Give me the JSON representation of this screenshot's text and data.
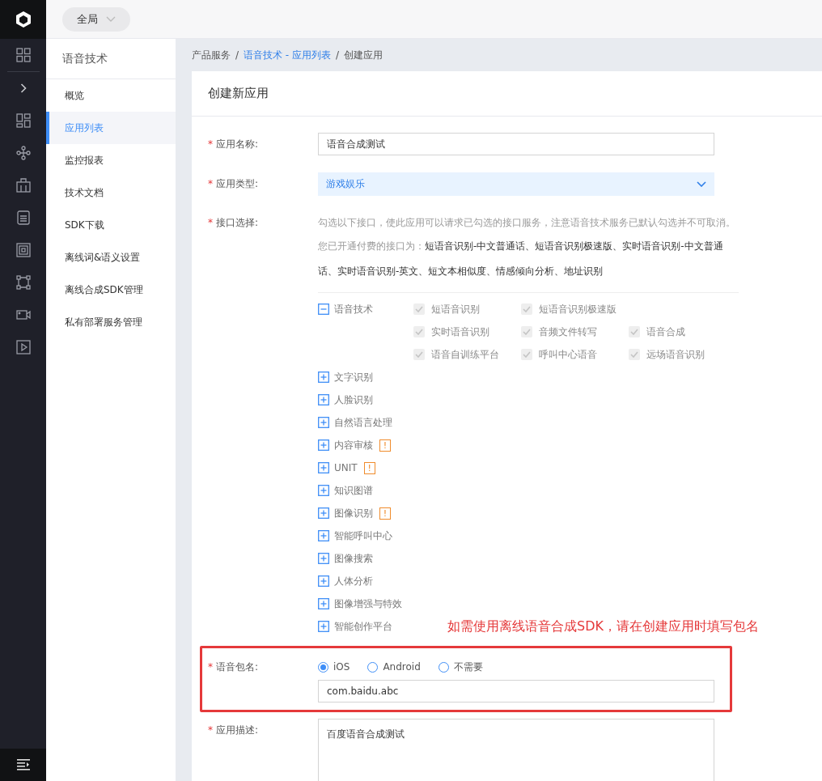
{
  "topbar": {
    "scope": "全局"
  },
  "sidebar": {
    "title": "语音技术",
    "items": [
      {
        "label": "概览",
        "selected": false
      },
      {
        "label": "应用列表",
        "selected": true
      },
      {
        "label": "监控报表",
        "selected": false
      },
      {
        "label": "技术文档",
        "selected": false
      },
      {
        "label": "SDK下载",
        "selected": false
      },
      {
        "label": "离线词&语义设置",
        "selected": false
      },
      {
        "label": "离线合成SDK管理",
        "selected": false
      },
      {
        "label": "私有部署服务管理",
        "selected": false
      }
    ]
  },
  "breadcrumb": [
    {
      "label": "产品服务",
      "link": false
    },
    {
      "label": "语音技术 - 应用列表",
      "link": true
    },
    {
      "label": "创建应用",
      "link": false
    }
  ],
  "breadcrumb_separator": "/",
  "card": {
    "title": "创建新应用"
  },
  "form": {
    "required_mark": "*",
    "app_name": {
      "label": "应用名称:",
      "value": "语音合成测试"
    },
    "app_type": {
      "label": "应用类型:",
      "value": "游戏娱乐"
    },
    "api": {
      "label": "接口选择:",
      "hint": "勾选以下接口，使此应用可以请求已勾选的接口服务，注意语音技术服务已默认勾选并不可取消。",
      "paid_label": "您已开通付费的接口为：",
      "paid_list": "短语音识别-中文普通话、短语音识别极速版、实时语音识别-中文普通话、实时语音识别-英文、短文本相似度、情感倾向分析、地址识别",
      "categories": [
        {
          "label": "语音技术",
          "expanded": true,
          "options": [
            [
              {
                "label": "短语音识别",
                "checked": true,
                "disabled": true
              },
              {
                "label": "短语音识别极速版",
                "checked": true,
                "disabled": true
              }
            ],
            [
              {
                "label": "实时语音识别",
                "checked": true,
                "disabled": true
              },
              {
                "label": "音频文件转写",
                "checked": true,
                "disabled": true
              },
              {
                "label": "语音合成",
                "checked": true,
                "disabled": true
              }
            ],
            [
              {
                "label": "语音自训练平台",
                "checked": true,
                "disabled": true
              },
              {
                "label": "呼叫中心语音",
                "checked": true,
                "disabled": true
              },
              {
                "label": "远场语音识别",
                "checked": true,
                "disabled": true
              }
            ]
          ]
        },
        {
          "label": "文字识别",
          "expanded": false
        },
        {
          "label": "人脸识别",
          "expanded": false
        },
        {
          "label": "自然语言处理",
          "expanded": false
        },
        {
          "label": "内容审核",
          "expanded": false,
          "badge": "!"
        },
        {
          "label": "UNIT",
          "expanded": false,
          "badge": "!"
        },
        {
          "label": "知识图谱",
          "expanded": false
        },
        {
          "label": "图像识别",
          "expanded": false,
          "badge": "!"
        },
        {
          "label": "智能呼叫中心",
          "expanded": false
        },
        {
          "label": "图像搜索",
          "expanded": false
        },
        {
          "label": "人体分析",
          "expanded": false
        },
        {
          "label": "图像增强与特效",
          "expanded": false
        },
        {
          "label": "智能创作平台",
          "expanded": false
        }
      ]
    },
    "annotation": "如需使用离线语音合成SDK，请在创建应用时填写包名",
    "package": {
      "label": "语音包名:",
      "options": [
        {
          "label": "iOS",
          "selected": true
        },
        {
          "label": "Android",
          "selected": false
        },
        {
          "label": "不需要",
          "selected": false
        }
      ],
      "value": "com.baidu.abc"
    },
    "description": {
      "label": "应用描述:",
      "value": "百度语音合成测试"
    }
  }
}
